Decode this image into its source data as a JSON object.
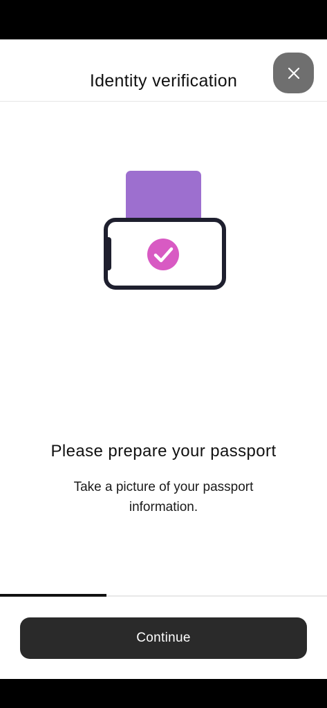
{
  "header": {
    "title": "Identity verification",
    "close_icon": "close-icon"
  },
  "illustration": {
    "icon": "passport-scan-check-icon",
    "colors": {
      "passport": "#9d6fcf",
      "phone_outline": "#1e1f2e",
      "check": "#d85ac3"
    }
  },
  "content": {
    "headline": "Please prepare your passport",
    "subtext": "Take a picture of your passport information."
  },
  "progress": {
    "fraction": 0.325
  },
  "footer": {
    "continue_label": "Continue"
  }
}
